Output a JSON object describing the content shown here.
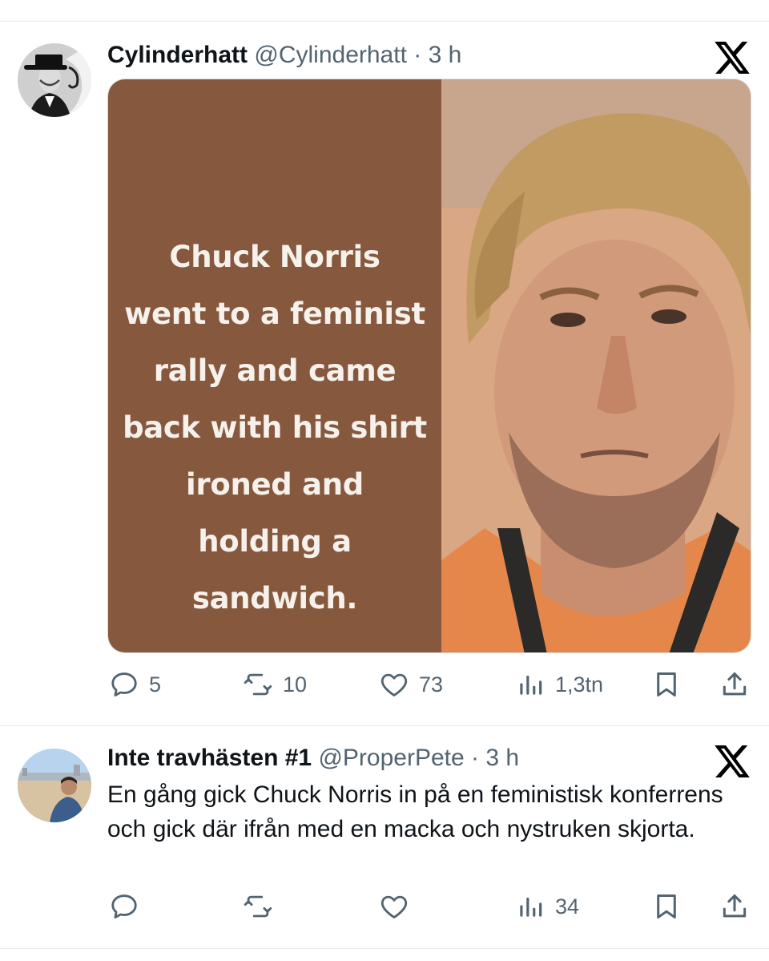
{
  "tweets": [
    {
      "display_name": "Cylinderhatt",
      "handle": "@Cylinderhatt",
      "separator": "·",
      "time": "3 h",
      "media_text": "Chuck Norris\nwent to a feminist\nrally and came\nback with his shirt\nironed and\nholding a\nsandwich.",
      "actions": {
        "replies": "5",
        "reposts": "10",
        "likes": "73",
        "views": "1,3tn"
      }
    },
    {
      "display_name": "Inte travhästen #1",
      "handle": "@ProperPete",
      "separator": "·",
      "time": "3 h",
      "text": "En gång gick Chuck Norris in på en feministisk konferrens och gick där ifrån med en macka och nystruken skjorta.",
      "actions": {
        "views": "34"
      }
    }
  ],
  "icons": {
    "reply": "speech-bubble-icon",
    "repost": "repost-arrows-icon",
    "like": "heart-icon",
    "views": "bar-chart-icon",
    "bookmark": "bookmark-icon",
    "share": "share-upload-icon",
    "platform": "x-logo-icon"
  },
  "colors": {
    "text_primary": "#0f1419",
    "text_secondary": "#536471",
    "meme_panel": "#86583e",
    "meme_text": "#f7f1ec",
    "divider": "#e6e9ec"
  }
}
